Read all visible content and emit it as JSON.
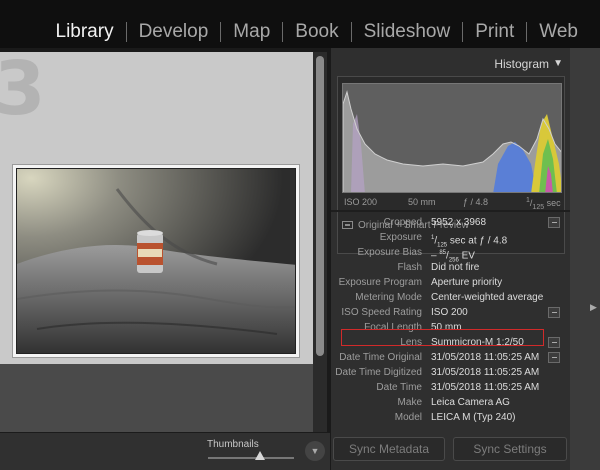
{
  "modules": {
    "library": "Library",
    "develop": "Develop",
    "map": "Map",
    "book": "Book",
    "slideshow": "Slideshow",
    "print": "Print",
    "web": "Web"
  },
  "loupe": {
    "cell_number": "3"
  },
  "toolbar": {
    "thumbnails_label": "Thumbnails",
    "thumbnails_slider_fraction": 0.6
  },
  "histogram": {
    "title": "Histogram",
    "iso": "ISO 200",
    "focal": "50 mm",
    "aperture": "ƒ / 4.8",
    "shutter_num": "1",
    "shutter_den": "125",
    "shutter_unit": "sec",
    "preview": "Original + Smart Preview"
  },
  "metadata": {
    "cropped": {
      "label": "Cropped",
      "value": "5952 x 3968"
    },
    "exposure": {
      "label": "Exposure",
      "num": "1",
      "den": "125",
      "rest": "sec at ƒ / 4.8"
    },
    "exposure_bias": {
      "label": "Exposure Bias",
      "prefix": "–",
      "num": "85",
      "den": "256",
      "rest": "EV"
    },
    "flash": {
      "label": "Flash",
      "value": "Did not fire"
    },
    "exposure_program": {
      "label": "Exposure Program",
      "value": "Aperture priority"
    },
    "metering_mode": {
      "label": "Metering Mode",
      "value": "Center-weighted average"
    },
    "iso": {
      "label": "ISO Speed Rating",
      "value": "ISO 200"
    },
    "focal_length": {
      "label": "Focal Length",
      "value": "50 mm"
    },
    "lens": {
      "label": "Lens",
      "value": "Summicron-M 1:2/50"
    },
    "dt_original": {
      "label": "Date Time Original",
      "value": "31/05/2018 11:05:25 AM"
    },
    "dt_digitized": {
      "label": "Date Time Digitized",
      "value": "31/05/2018 11:05:25 AM"
    },
    "dt": {
      "label": "Date Time",
      "value": "31/05/2018 11:05:25 AM"
    },
    "make": {
      "label": "Make",
      "value": "Leica Camera AG"
    },
    "model": {
      "label": "Model",
      "value": "LEICA M (Typ 240)"
    }
  },
  "buttons": {
    "sync_metadata": "Sync Metadata",
    "sync_settings": "Sync Settings"
  },
  "colors": {
    "highlight": "#d12a2a",
    "active_module": "#f2f2f2"
  }
}
